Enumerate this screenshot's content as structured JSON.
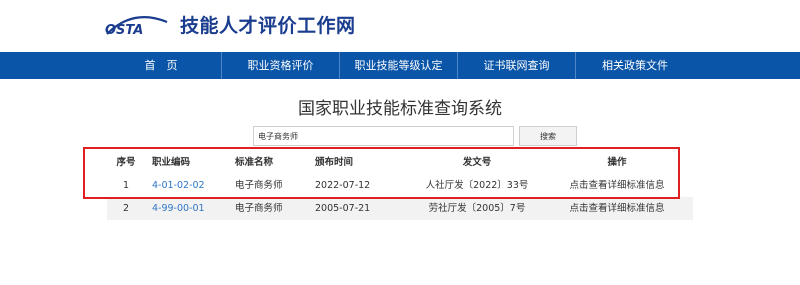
{
  "header": {
    "logo_text": "OSTA",
    "site_title": "技能人才评价工作网"
  },
  "nav": {
    "items": [
      {
        "label": "首　页"
      },
      {
        "label": "职业资格评价"
      },
      {
        "label": "职业技能等级认定"
      },
      {
        "label": "证书联网查询"
      },
      {
        "label": "相关政策文件"
      }
    ]
  },
  "main": {
    "title": "国家职业技能标准查询系统",
    "search": {
      "value": "电子商务师",
      "button_label": "搜索"
    },
    "table": {
      "headers": [
        "序号",
        "职业编码",
        "标准名称",
        "颁布时间",
        "发文号",
        "操作"
      ],
      "rows": [
        {
          "index": "1",
          "code": "4-01-02-02",
          "name": "电子商务师",
          "date": "2022-07-12",
          "doc": "人社厅发〔2022〕33号",
          "action": "点击查看详细标准信息"
        },
        {
          "index": "2",
          "code": "4-99-00-01",
          "name": "电子商务师",
          "date": "2005-07-21",
          "doc": "劳社厅发〔2005〕7号",
          "action": "点击查看详细标准信息"
        }
      ]
    }
  },
  "colors": {
    "nav_background": "#0a55a8",
    "title_blue": "#1a3d8f",
    "link_blue": "#2e77c6",
    "highlight": "#e02020"
  }
}
